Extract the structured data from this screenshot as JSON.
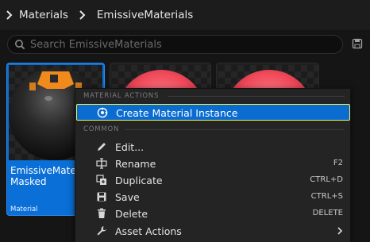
{
  "breadcrumb": {
    "items": [
      "Materials",
      "EmissiveMaterials"
    ]
  },
  "search": {
    "placeholder": "Search EmissiveMaterials"
  },
  "assets": [
    {
      "name": "EmissiveMaterial\nMasked",
      "type": "Material",
      "selected": true
    },
    {
      "name": "",
      "type": "",
      "selected": false
    },
    {
      "name": "",
      "type": "",
      "selected": false
    }
  ],
  "context_menu": {
    "sections": {
      "material_actions": "MATERIAL ACTIONS",
      "common": "COMMON"
    },
    "items": [
      {
        "label": "Create Material Instance",
        "icon": "material-instance-icon",
        "shortcut": ""
      },
      {
        "label": "Edit...",
        "icon": "edit-icon",
        "shortcut": ""
      },
      {
        "label": "Rename",
        "icon": "rename-icon",
        "shortcut": "F2"
      },
      {
        "label": "Duplicate",
        "icon": "duplicate-icon",
        "shortcut": "CTRL+D"
      },
      {
        "label": "Save",
        "icon": "save-icon",
        "shortcut": "CTRL+S"
      },
      {
        "label": "Delete",
        "icon": "trash-icon",
        "shortcut": "DELETE"
      },
      {
        "label": "Asset Actions",
        "icon": "wrench-icon",
        "shortcut": ""
      }
    ]
  },
  "colors": {
    "selection_blue": "#0a6cd0",
    "highlight_border": "#f3f34a",
    "emissive_orange": "#f08a1c",
    "emissive_pink": "#f04a5a"
  }
}
